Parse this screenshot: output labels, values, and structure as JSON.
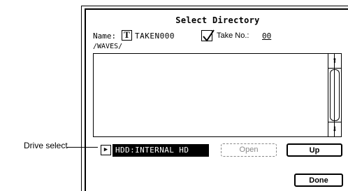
{
  "callout": {
    "label": "Drive select"
  },
  "dialog": {
    "title": "Select Directory",
    "name_label": "Name:",
    "name_type_glyph": "T",
    "name_value": "TAKEN000",
    "take_label": "Take No.:",
    "take_value": "00",
    "take_checked": true,
    "path": "/WAVES/",
    "list_items": [],
    "scroll_up_glyph": "⬆",
    "scroll_down_glyph": "⬇",
    "drive_arrow_glyph": "▶",
    "drive_value": "HDD:INTERNAL HD",
    "open_label": "Open",
    "up_label": "Up",
    "done_label": "Done"
  }
}
